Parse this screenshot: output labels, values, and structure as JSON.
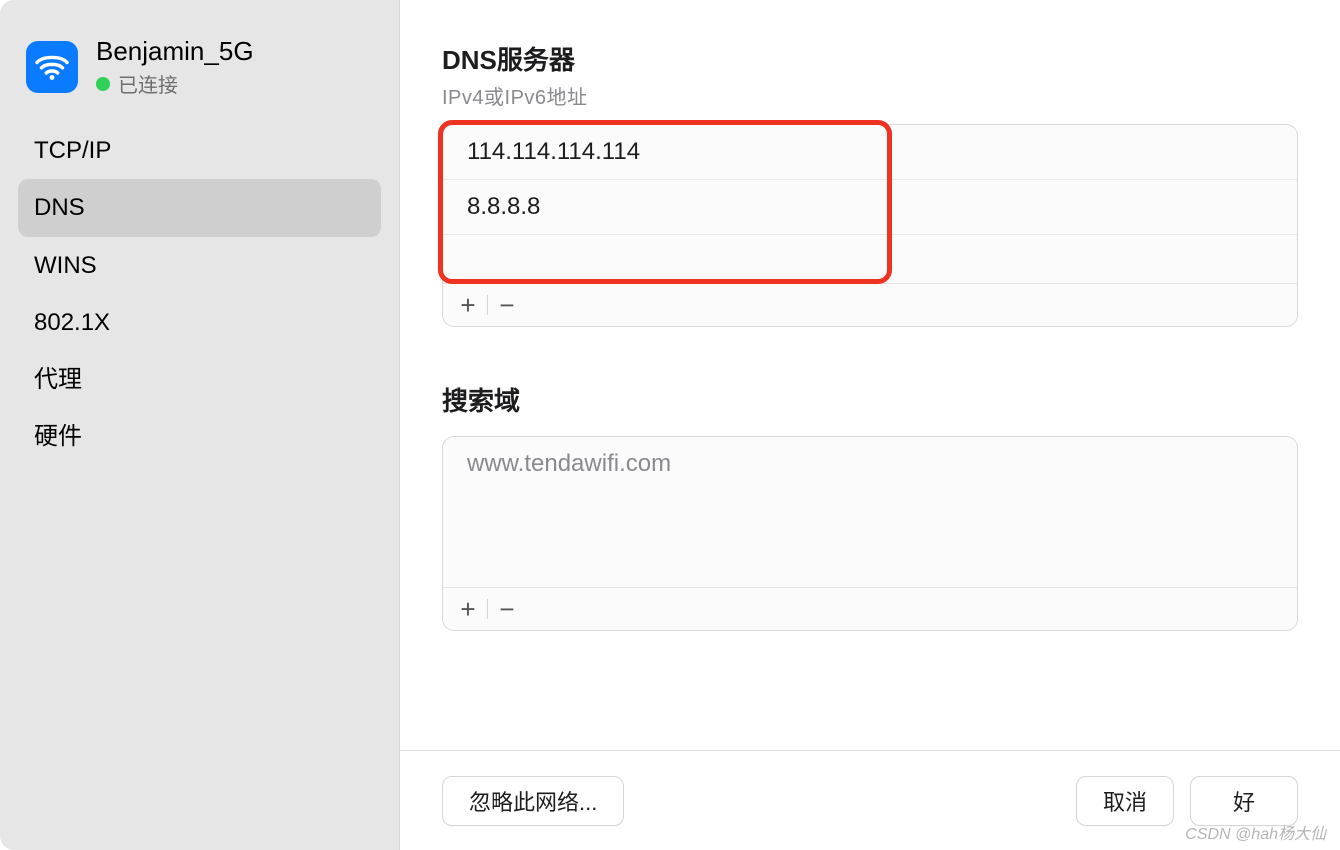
{
  "sidebar": {
    "network_name": "Benjamin_5G",
    "status_text": "已连接",
    "tabs": [
      {
        "label": "TCP/IP"
      },
      {
        "label": "DNS"
      },
      {
        "label": "WINS"
      },
      {
        "label": "802.1X"
      },
      {
        "label": "代理"
      },
      {
        "label": "硬件"
      }
    ],
    "selected_index": 1
  },
  "dns_section": {
    "title": "DNS服务器",
    "subtitle": "IPv4或IPv6地址",
    "servers": [
      "114.114.114.114",
      "8.8.8.8"
    ],
    "add_label": "+",
    "remove_label": "−"
  },
  "search_section": {
    "title": "搜索域",
    "domains": [
      "www.tendawifi.com"
    ],
    "add_label": "+",
    "remove_label": "−"
  },
  "footer": {
    "forget_label": "忽略此网络...",
    "cancel_label": "取消",
    "ok_label": "好"
  },
  "watermark": "CSDN @hah杨大仙"
}
